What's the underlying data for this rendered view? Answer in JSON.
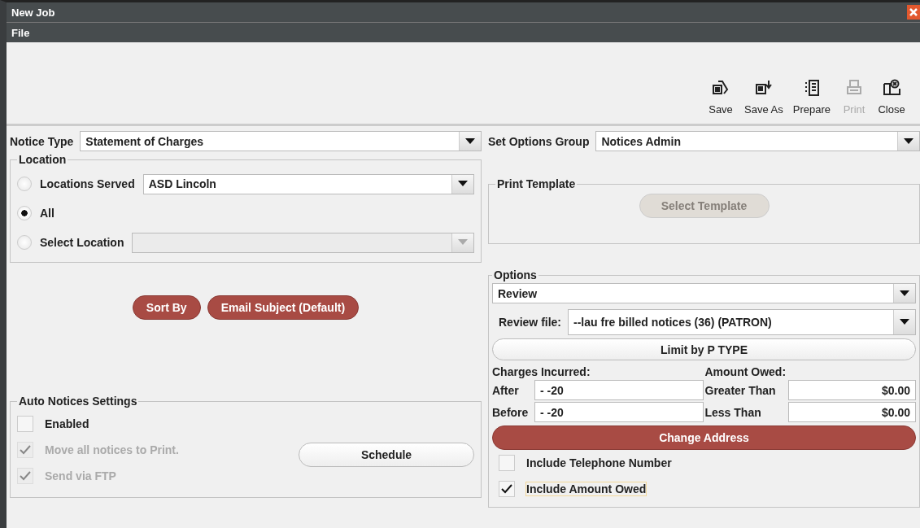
{
  "window": {
    "title": "New Job"
  },
  "menu": [
    "File"
  ],
  "toolbar": [
    {
      "kind": "save",
      "label": "Save",
      "disabled": false
    },
    {
      "kind": "saveas",
      "label": "Save As",
      "disabled": false
    },
    {
      "kind": "prepare",
      "label": "Prepare",
      "disabled": false
    },
    {
      "kind": "print",
      "label": "Print",
      "disabled": true
    },
    {
      "kind": "close",
      "label": "Close",
      "disabled": false
    }
  ],
  "notice_type": {
    "label": "Notice Type",
    "value": "Statement of Charges"
  },
  "location": {
    "title": "Location",
    "options": [
      {
        "label": "Locations Served",
        "selected": false,
        "value": "ASD Lincoln",
        "disabled": false
      },
      {
        "label": "All",
        "selected": true
      },
      {
        "label": "Select Location",
        "selected": false,
        "disabled": true
      }
    ]
  },
  "left_buttons": [
    "Sort By",
    "Email Subject (Default)"
  ],
  "auto_notices": {
    "title": "Auto Notices Settings",
    "checkboxes": [
      {
        "label": "Enabled",
        "checked": false,
        "disabled": false
      },
      {
        "label": "Move all notices to Print.",
        "checked": true,
        "disabled": true
      },
      {
        "label": "Send via FTP",
        "checked": true,
        "disabled": true
      }
    ],
    "schedule_button": "Schedule"
  },
  "options_group": {
    "label": "Set Options Group",
    "value": "Notices Admin"
  },
  "print_template": {
    "title": "Print Template",
    "button": "Select Template",
    "disabled": true
  },
  "options": {
    "title": "Options",
    "mode": "Review",
    "review_file_label": "Review file:",
    "review_file": "--lau fre billed notices (36) (PATRON)",
    "limit_button": "Limit by P TYPE",
    "charges": {
      "title": "Charges Incurred:",
      "fields": [
        {
          "label": "After",
          "value": "-  -20"
        },
        {
          "label": "Before",
          "value": "-  -20"
        }
      ]
    },
    "owed": {
      "title": "Amount Owed:",
      "fields": [
        {
          "label": "Greater Than",
          "value": "$0.00"
        },
        {
          "label": "Less Than",
          "value": "$0.00"
        }
      ]
    },
    "change_address_button": "Change Address",
    "checkboxes": [
      {
        "label": "Include Telephone Number",
        "checked": false,
        "focused": false
      },
      {
        "label": "Include Amount Owed",
        "checked": true,
        "focused": true
      }
    ]
  }
}
